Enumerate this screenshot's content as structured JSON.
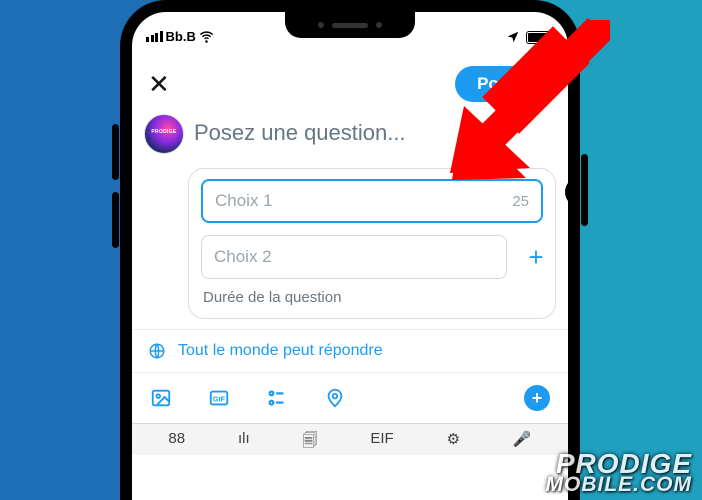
{
  "status": {
    "carrier": "Bb.B"
  },
  "topbar": {
    "post_label": "Poster"
  },
  "compose": {
    "question_placeholder": "Posez une question..."
  },
  "poll": {
    "choice1": {
      "placeholder": "Choix 1",
      "char_count": "25"
    },
    "choice2": {
      "placeholder": "Choix 2"
    },
    "duration_label": "Durée de la question"
  },
  "reply": {
    "label": "Tout le monde peut répondre"
  },
  "keyboard": {
    "k1": "88",
    "k2": "ılı",
    "k3": "🗐",
    "k4": "EIF",
    "k5": "⚙",
    "k6": "🎤"
  },
  "watermark": {
    "line1": "PRODIGE",
    "line2": "MOBILE.COM"
  },
  "colors": {
    "accent": "#1d9bf0",
    "arrow": "#ff0000"
  }
}
